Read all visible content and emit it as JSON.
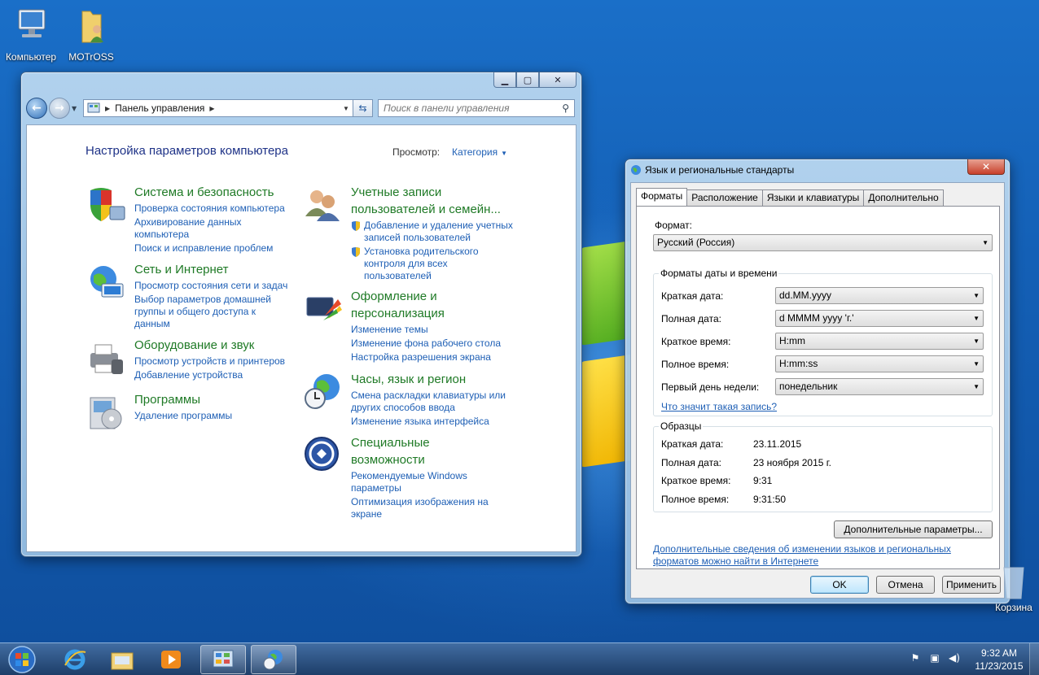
{
  "desktop": {
    "icons": [
      {
        "label": "Компьютер",
        "icon": "computer-icon"
      },
      {
        "label": "MOTrOSS",
        "icon": "user-folder-icon"
      },
      {
        "label": "Корзина",
        "icon": "recycle-bin-icon"
      }
    ]
  },
  "control_panel": {
    "address": "Панель управления",
    "search_placeholder": "Поиск в панели управления",
    "title": "Настройка параметров компьютера",
    "view_label": "Просмотр:",
    "view_value": "Категория",
    "categories": [
      {
        "title": "Система и безопасность",
        "icon": "security-shield-icon",
        "links": [
          "Проверка состояния компьютера",
          "Архивирование данных компьютера",
          "Поиск и исправление проблем"
        ]
      },
      {
        "title": "Сеть и Интернет",
        "icon": "network-globe-icon",
        "links": [
          "Просмотр состояния сети и задач",
          "Выбор параметров домашней группы и общего доступа к данным"
        ]
      },
      {
        "title": "Оборудование и звук",
        "icon": "printer-icon",
        "links": [
          "Просмотр устройств и принтеров",
          "Добавление устройства"
        ]
      },
      {
        "title": "Программы",
        "icon": "programs-icon",
        "links": [
          "Удаление программы"
        ]
      },
      {
        "title": "Учетные записи пользователей и семейн...",
        "icon": "users-icon",
        "links": [
          "Добавление и удаление учетных записей пользователей",
          "Установка родительского контроля для всех пользователей"
        ]
      },
      {
        "title": "Оформление и персонализация",
        "icon": "personalization-icon",
        "links": [
          "Изменение темы",
          "Изменение фона рабочего стола",
          "Настройка разрешения экрана"
        ]
      },
      {
        "title": "Часы, язык и регион",
        "icon": "clock-globe-icon",
        "links": [
          "Смена раскладки клавиатуры или других способов ввода",
          "Изменение языка интерфейса"
        ]
      },
      {
        "title": "Специальные возможности",
        "icon": "accessibility-icon",
        "links": [
          "Рекомендуемые Windows параметры",
          "Оптимизация изображения на экране"
        ]
      }
    ]
  },
  "region_dialog": {
    "title": "Язык и региональные стандарты",
    "tabs": [
      "Форматы",
      "Расположение",
      "Языки и клавиатуры",
      "Дополнительно"
    ],
    "format_label": "Формат:",
    "format_value": "Русский (Россия)",
    "datetime_group": "Форматы даты и времени",
    "rows": [
      {
        "label": "Краткая дата:",
        "value": "dd.MM.yyyy"
      },
      {
        "label": "Полная дата:",
        "value": "d MMMM yyyy 'г.'"
      },
      {
        "label": "Краткое время:",
        "value": "H:mm"
      },
      {
        "label": "Полное время:",
        "value": "H:mm:ss"
      },
      {
        "label": "Первый день недели:",
        "value": "понедельник"
      }
    ],
    "notation_link": "Что значит такая запись?",
    "samples_group": "Образцы",
    "samples": [
      {
        "label": "Краткая дата:",
        "value": "23.11.2015"
      },
      {
        "label": "Полная дата:",
        "value": "23 ноября 2015 г."
      },
      {
        "label": "Краткое время:",
        "value": "9:31"
      },
      {
        "label": "Полное время:",
        "value": "9:31:50"
      }
    ],
    "advanced_button": "Дополнительные параметры...",
    "info_link_line1": "Дополнительные сведения об изменении языков и региональных",
    "info_link_line2": "форматов можно найти в Интернете",
    "ok": "OK",
    "cancel": "Отмена",
    "apply": "Применить"
  },
  "taskbar": {
    "time": "9:32 AM",
    "date": "11/23/2015"
  }
}
